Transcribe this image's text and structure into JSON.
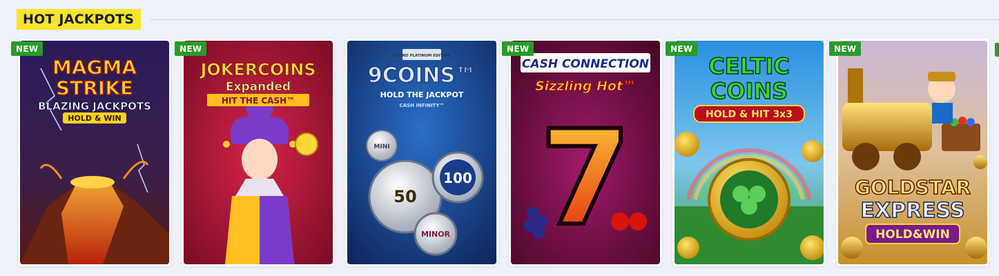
{
  "section": {
    "title": "HOT JACKPOTS"
  },
  "badge_color": "#2a9a2a",
  "accent": "#f5e62a",
  "games": [
    {
      "new_label": "NEW",
      "line1": "MAGMA",
      "line2": "STRIKE",
      "line3": "BLAZING JACKPOTS",
      "line4": "HOLD & WIN"
    },
    {
      "new_label": "NEW",
      "line1": "JOKERCOINS",
      "line2": "Expanded",
      "line3": "HIT THE CASH™"
    },
    {
      "new_label": "",
      "line0": "GRAND PLATINUM EDITION",
      "line1": "9COINS™",
      "line2": "HOLD THE JACKPOT",
      "line3": "CASH INFINITY™",
      "coin_mini": "MINI",
      "coin_50": "50",
      "coin_100": "100",
      "coin_minor": "MINOR"
    },
    {
      "new_label": "NEW",
      "line1": "CASH CONNECTION",
      "line2": "Sizzling Hot™",
      "big": "7"
    },
    {
      "new_label": "NEW",
      "line1": "CELTIC",
      "line2": "COINS",
      "line3": "HOLD & HIT 3x3"
    },
    {
      "new_label": "NEW",
      "line1": "GOLDSTAR",
      "line2": "EXPRESS",
      "line3": "HOLD&WIN"
    }
  ]
}
